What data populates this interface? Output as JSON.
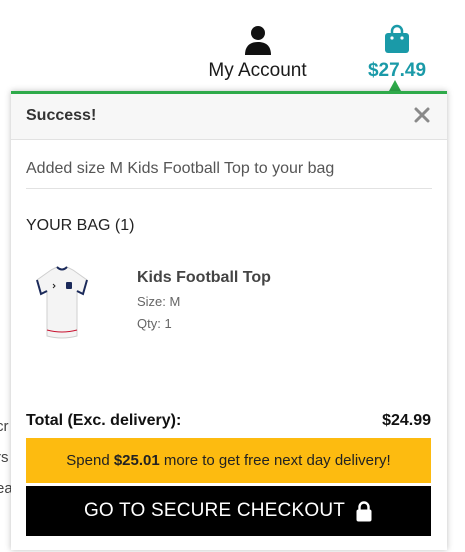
{
  "header": {
    "account_label": "My Account",
    "account_icon": "user-icon",
    "bag_icon": "shopping-bag-icon",
    "bag_total": "$27.49",
    "accent_color": "#1a9aa8"
  },
  "background_fragments": [
    "cr",
    "rs",
    "ea"
  ],
  "popup": {
    "title": "Success!",
    "close_icon": "close-icon",
    "message": "Added size M Kids Football Top to your bag",
    "bag_heading": "YOUR BAG (1)",
    "border_color": "#2eaa4a",
    "item": {
      "name": "Kids Football Top",
      "size": "Size: M",
      "qty": "Qty: 1",
      "thumbnail": "football-shirt-image"
    },
    "total_label": "Total (Exc. delivery):",
    "total_value": "$24.99",
    "promo": {
      "prefix": "Spend ",
      "amount": "$25.01",
      "suffix": " more to get free next day delivery!",
      "background": "#fdbb10"
    },
    "checkout_label": "GO TO SECURE CHECKOUT",
    "checkout_icon": "lock-icon"
  }
}
